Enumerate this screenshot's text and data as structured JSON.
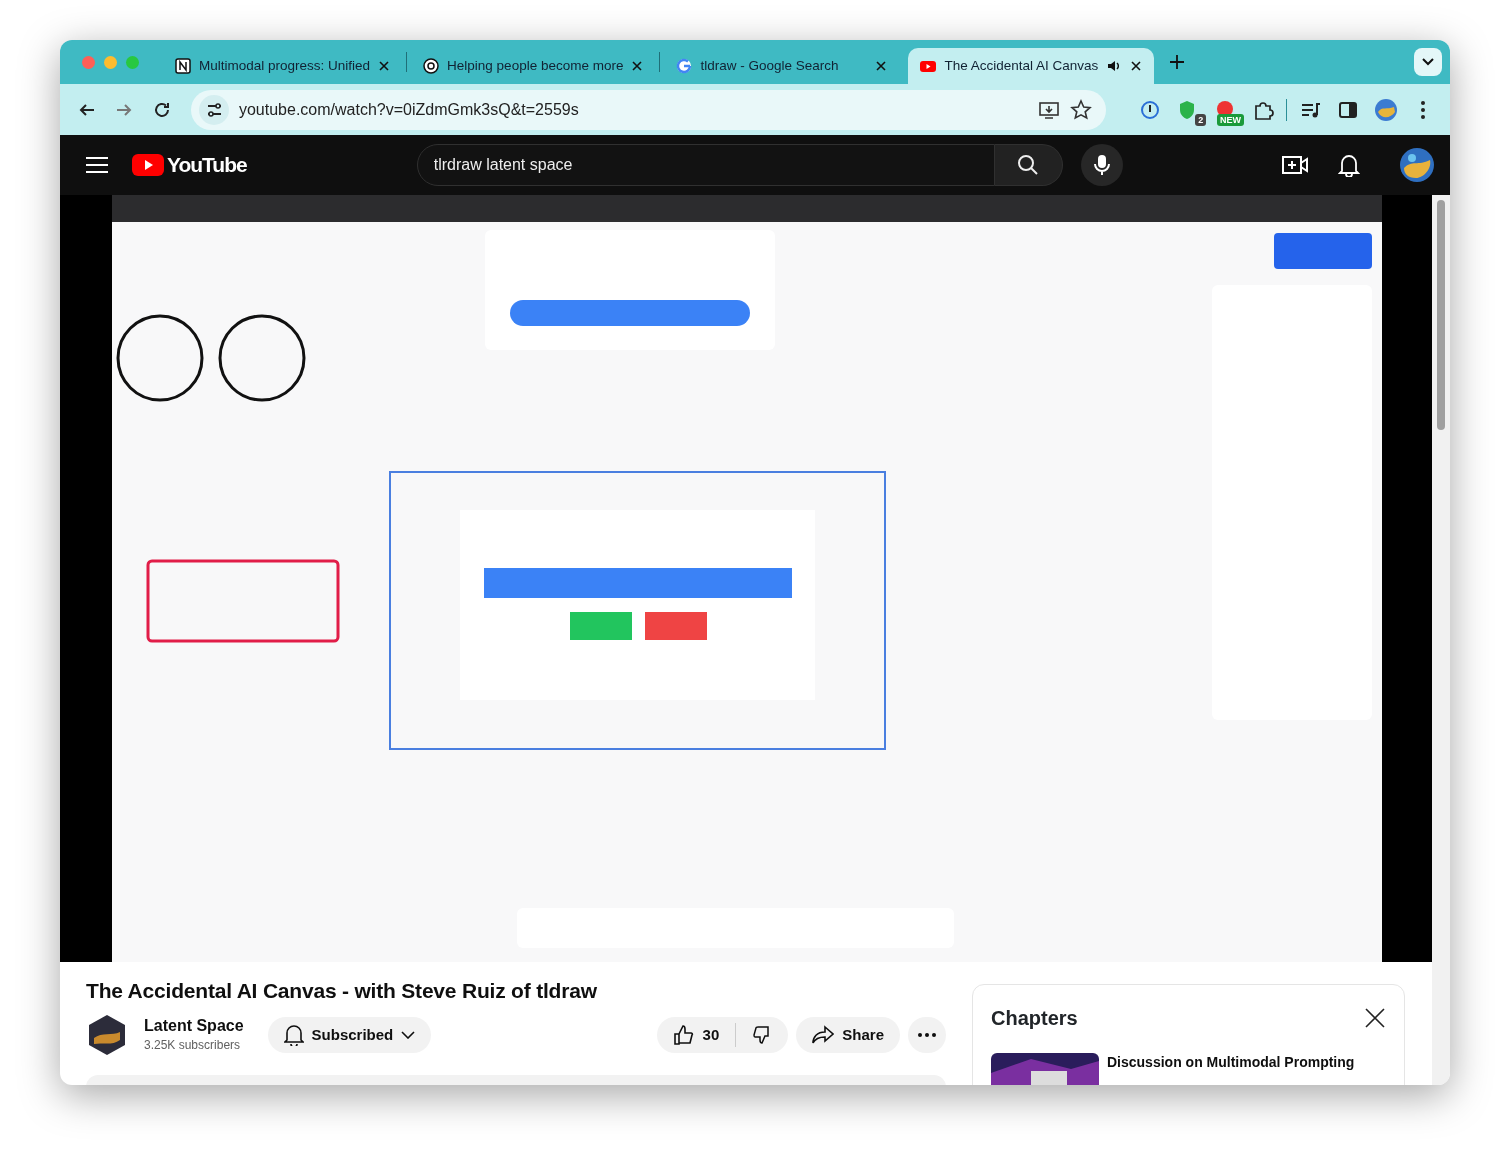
{
  "browser": {
    "tabs": [
      {
        "title": "Multimodal progress: Unified",
        "selected": false,
        "audio": false
      },
      {
        "title": "Helping people become more",
        "selected": false,
        "audio": false
      },
      {
        "title": "tldraw - Google Search",
        "selected": false,
        "audio": false
      },
      {
        "title": "The Accidental AI Canvas",
        "selected": true,
        "audio": true
      }
    ],
    "address": "youtube.com/watch?v=0iZdmGmk3sQ&t=2559s",
    "extension_badges": [
      "2",
      "NEW"
    ]
  },
  "youtube": {
    "logo": "YouTube",
    "search": "tlrdraw latent space",
    "title": "The Accidental AI Canvas - with Steve Ruiz of tldraw",
    "channel": {
      "name": "Latent Space",
      "subscribers": "3.25K subscribers"
    },
    "subscribe_button": "Subscribed",
    "likes": "30",
    "share_button": "Share",
    "chapters": {
      "heading": "Chapters",
      "items": [
        {
          "title": "Discussion on Multimodal Prompting"
        }
      ]
    }
  }
}
